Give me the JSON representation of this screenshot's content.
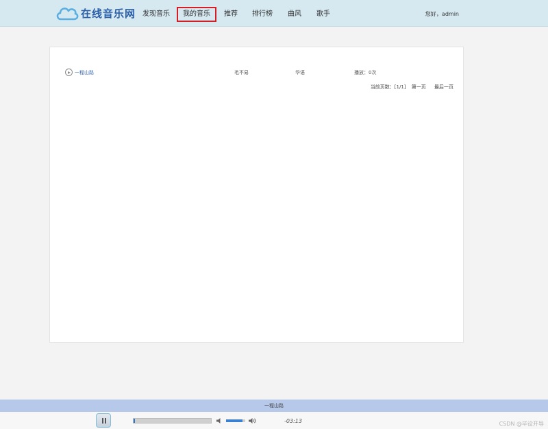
{
  "header": {
    "site_name": "在线音乐网",
    "nav": [
      "发现音乐",
      "我的音乐",
      "推荐",
      "排行榜",
      "曲风",
      "歌手"
    ],
    "active_nav": "我的音乐",
    "greeting": "您好，",
    "username": "admin"
  },
  "song_list": [
    {
      "title": "一程山路",
      "artist": "毛不易",
      "genre": "华语",
      "plays": "播放：0次"
    }
  ],
  "pager": {
    "current_label": "当前页数：[1/1]",
    "first_label": "第一页",
    "last_label": "最后一页"
  },
  "player": {
    "now_playing": "一程山路",
    "time": "-03:13",
    "progress_fraction": 0.0,
    "volume_fraction": 0.85
  },
  "watermark": "CSDN @毕设开导",
  "colors": {
    "header_bg": "#d6e9f1",
    "logo_blue": "#2a5ea8",
    "active_border": "#d21f26",
    "player_title_bg": "#b7c9ea",
    "link_blue": "#3a68b0"
  },
  "icons": {
    "logo": "cloud-icon",
    "song_action": "play-circle-icon",
    "player_control": "pause-icon",
    "volume_low": "volume-mute-icon",
    "volume_high": "volume-up-icon"
  }
}
